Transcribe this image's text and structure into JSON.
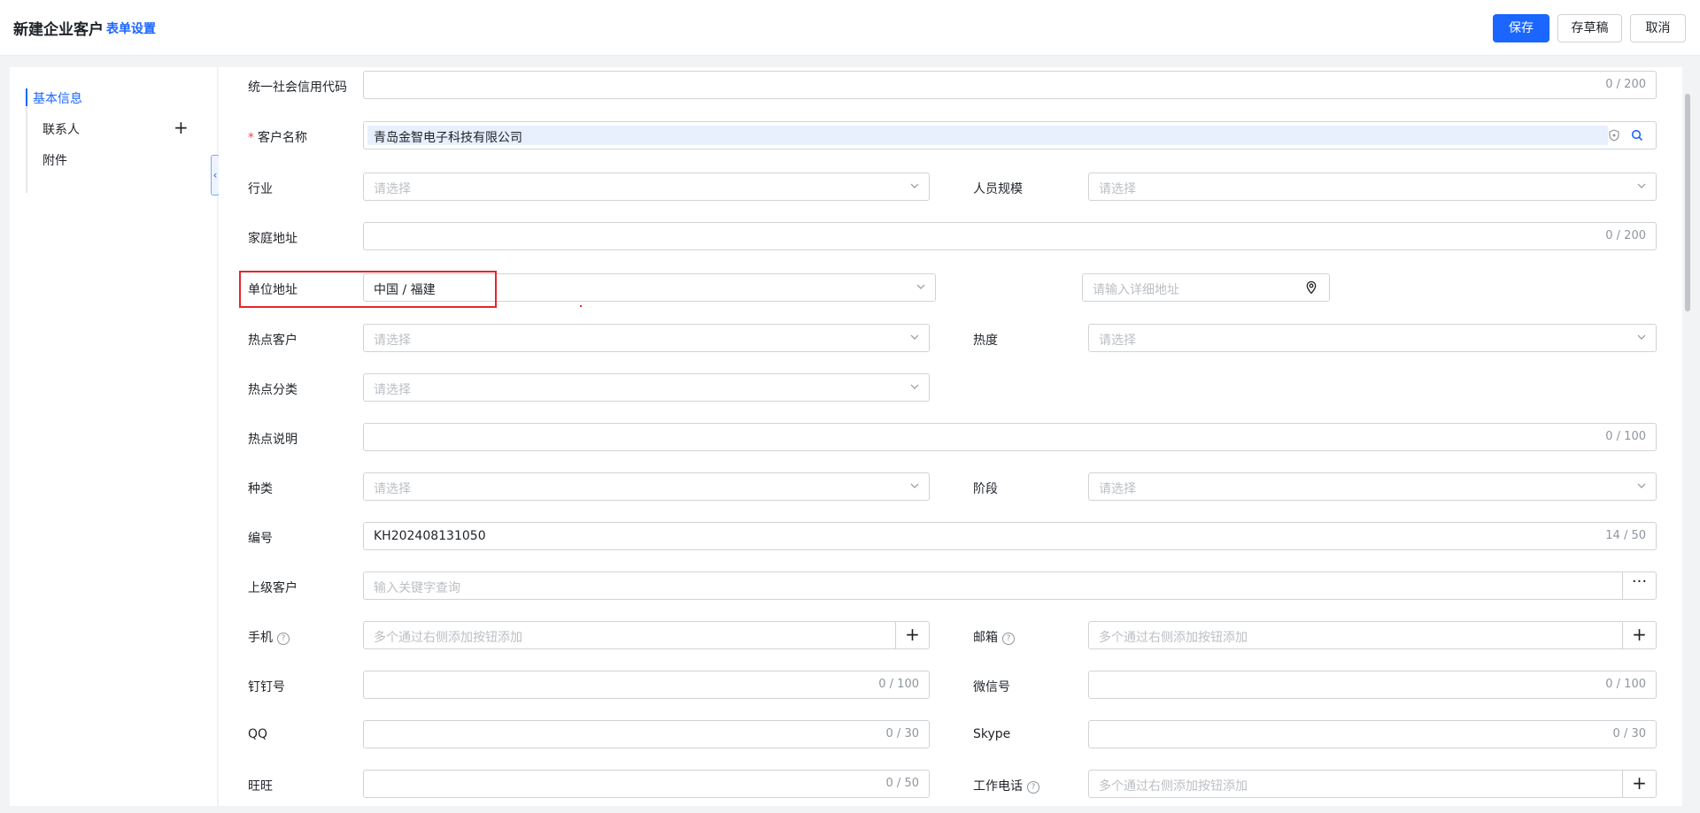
{
  "header": {
    "title": "新建企业客户",
    "form_settings": "表单设置",
    "save": "保存",
    "draft": "存草稿",
    "cancel": "取消"
  },
  "sidebar": {
    "items": [
      {
        "label": "基本信息",
        "active": true
      },
      {
        "label": "联系人",
        "has_add": true
      },
      {
        "label": "附件"
      }
    ],
    "add_icon": "plus-icon"
  },
  "form": {
    "credit_code": {
      "label": "统一社会信用代码",
      "value": "",
      "count": "0 / 200"
    },
    "customer_name": {
      "label": "客户名称",
      "required_mark": "*",
      "value": "青岛金智电子科技有限公司"
    },
    "industry": {
      "label": "行业",
      "placeholder": "请选择"
    },
    "staff_size": {
      "label": "人员规模",
      "placeholder": "请选择"
    },
    "home_address": {
      "label": "家庭地址",
      "count": "0 / 200"
    },
    "work_address": {
      "label": "单位地址",
      "value": "中国 / 福建",
      "detail_placeholder": "请输入详细地址"
    },
    "hot_customer": {
      "label": "热点客户",
      "placeholder": "请选择"
    },
    "heat": {
      "label": "热度",
      "placeholder": "请选择"
    },
    "hot_category": {
      "label": "热点分类",
      "placeholder": "请选择"
    },
    "hot_desc": {
      "label": "热点说明",
      "count": "0 / 100"
    },
    "kind": {
      "label": "种类",
      "placeholder": "请选择"
    },
    "stage": {
      "label": "阶段",
      "placeholder": "请选择"
    },
    "number": {
      "label": "编号",
      "value": "KH202408131050",
      "count": "14 / 50"
    },
    "parent_customer": {
      "label": "上级客户",
      "placeholder": "输入关键字查询",
      "more": "···"
    },
    "mobile": {
      "label": "手机",
      "placeholder": "多个通过右侧添加按钮添加",
      "add": "+"
    },
    "email": {
      "label": "邮箱",
      "placeholder": "多个通过右侧添加按钮添加",
      "add": "+"
    },
    "dingtalk": {
      "label": "钉钉号",
      "count": "0 / 100"
    },
    "wechat": {
      "label": "微信号",
      "count": "0 / 100"
    },
    "qq": {
      "label": "QQ",
      "count": "0 / 30"
    },
    "skype": {
      "label": "Skype",
      "count": "0 / 30"
    },
    "wangwang": {
      "label": "旺旺",
      "count": "0 / 50"
    },
    "work_phone": {
      "label": "工作电话",
      "placeholder": "多个通过右侧添加按钮添加",
      "add": "+"
    }
  },
  "colors": {
    "accent": "#1a66ff",
    "highlight_box": "#e5252b",
    "required": "#f54a45"
  }
}
